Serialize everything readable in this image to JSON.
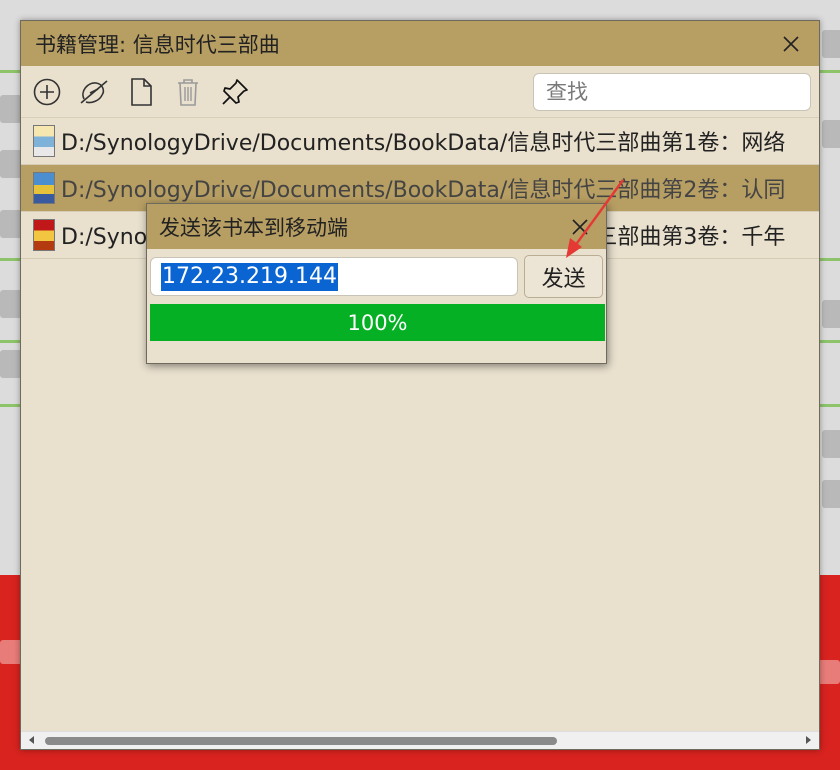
{
  "window": {
    "title": "书籍管理: 信息时代三部曲"
  },
  "toolbar": {
    "icons": [
      "add-icon",
      "unlink-icon",
      "new-file-icon",
      "trash-icon",
      "pin-icon"
    ],
    "search_placeholder": "查找"
  },
  "books": [
    {
      "path": "D:/SynologyDrive/Documents/BookData/信息时代三部曲第1卷：网络"
    },
    {
      "path": "D:/SynologyDrive/Documents/BookData/信息时代三部曲第2卷：认同",
      "selected": true
    },
    {
      "path": "D:/SynologyDrive/Documents/BookData/信息时代三部曲第3卷：千年"
    }
  ],
  "dialog": {
    "title": "发送该书本到移动端",
    "ip_value": "172.23.219.144",
    "send_label": "发送",
    "progress": 100,
    "progress_label": "100%"
  },
  "colors": {
    "titlebar": "#b79e63",
    "window_bg": "#e9e0ce",
    "progress": "#06b025",
    "selection": "#0a64d2",
    "annotation": "#e53935"
  }
}
